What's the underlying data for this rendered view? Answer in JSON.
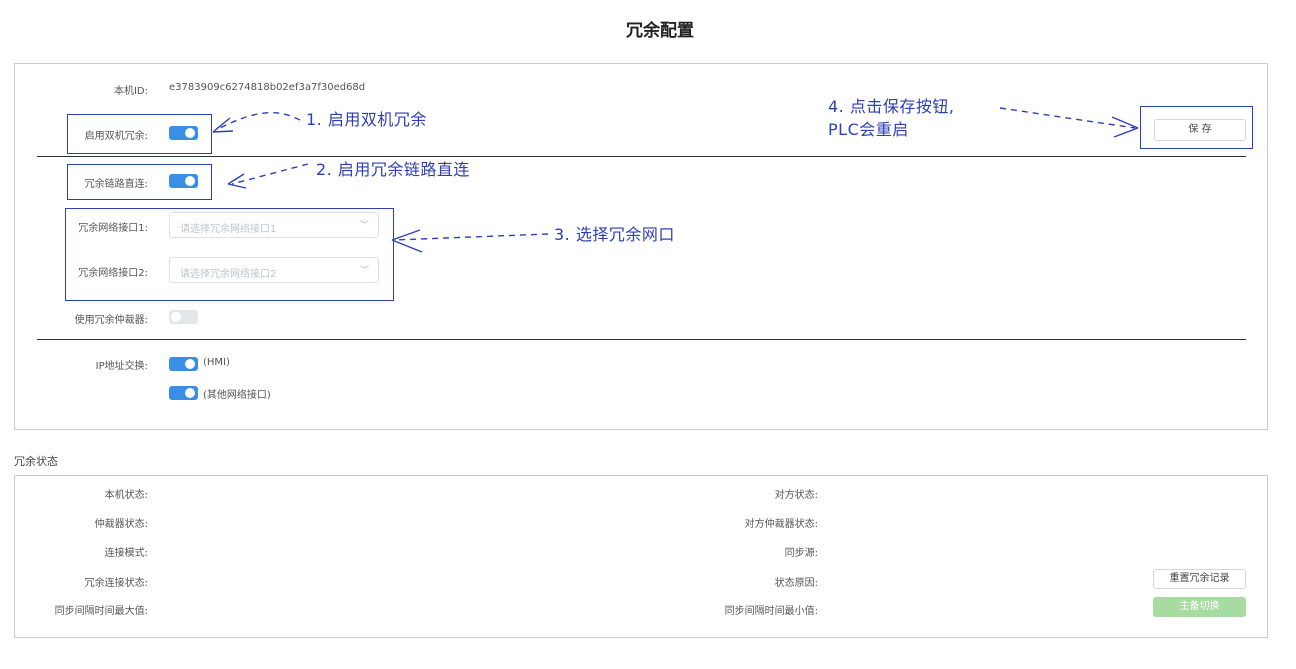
{
  "title": "冗余配置",
  "config": {
    "device_id_label": "本机ID:",
    "device_id_value": "e3783909c6274818b02ef3a7f30ed68d",
    "enable_redundancy_label": "启用双机冗余:",
    "enable_redundancy_on": true,
    "direct_link_label": "冗余链路直连:",
    "direct_link_on": true,
    "iface1_label": "冗余网络接口1:",
    "iface1_placeholder": "请选择冗余网络接口1",
    "iface2_label": "冗余网络接口2:",
    "iface2_placeholder": "请选择冗余网络接口2",
    "arbiter_label": "使用冗余仲裁器:",
    "arbiter_on": false,
    "ip_swap_label": "IP地址交换:",
    "ip_swap_hmi": "(HMI)",
    "ip_swap_hmi_on": true,
    "ip_swap_other": "(其他网络接口)",
    "ip_swap_other_on": true,
    "save_button": "保 存",
    "chevron": "﹀"
  },
  "annotations": {
    "step1": "1. 启用双机冗余",
    "step2": "2. 启用冗余链路直连",
    "step3": "3. 选择冗余网口",
    "step4_line1": "4. 点击保存按钮,",
    "step4_line2": "PLC会重启",
    "color": "#2d3fb5"
  },
  "status": {
    "section_title": "冗余状态",
    "local_state": "本机状态:",
    "peer_state": "对方状态:",
    "arbiter_state": "仲裁器状态:",
    "peer_arbiter_state": "对方仲裁器状态:",
    "connection_mode": "连接模式:",
    "sync_source": "同步源:",
    "redundancy_conn_state": "冗余连接状态:",
    "state_reason": "状态原因:",
    "sync_interval_max": "同步间隔时间最大值:",
    "sync_interval_min": "同步间隔时间最小值:",
    "reset_button": "重置冗余记录",
    "switch_button": "主备切换"
  },
  "colors": {
    "toggle_on": "#3a8ee6",
    "toggle_off": "#e4e6ea",
    "switch_button": "#a8dba1"
  }
}
